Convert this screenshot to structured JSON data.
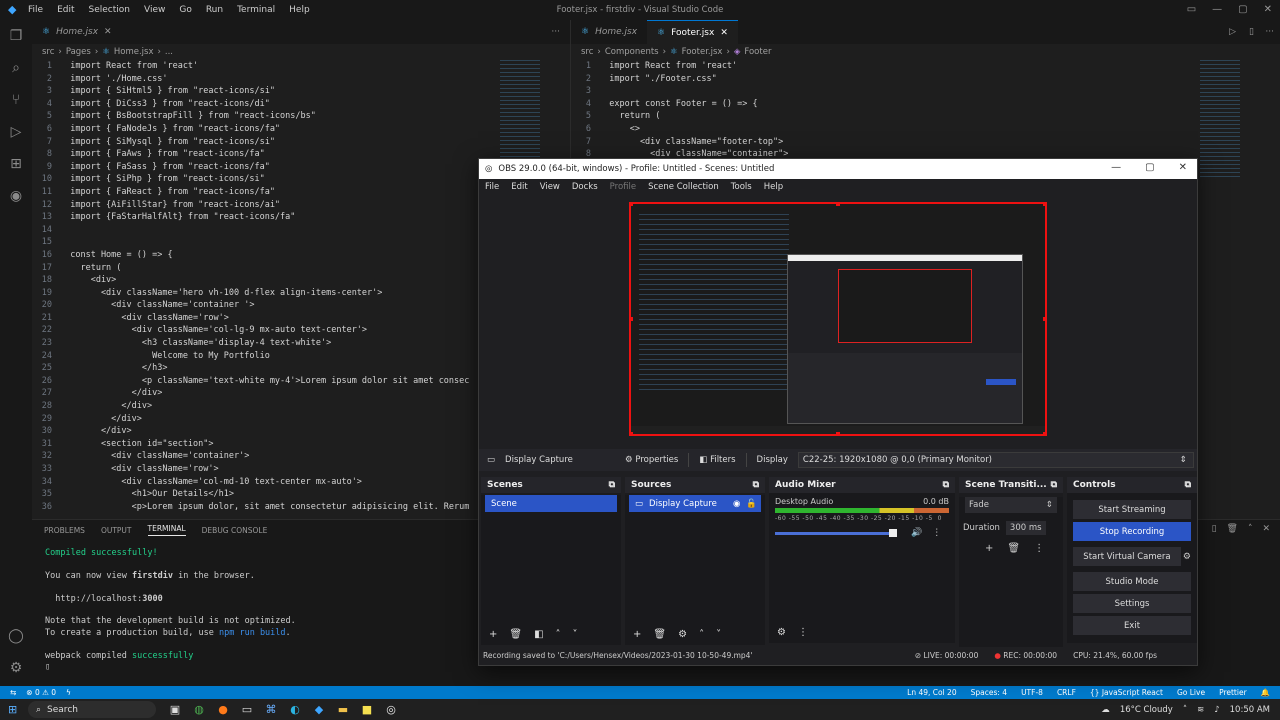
{
  "vscode": {
    "title": "Footer.jsx - firstdiv - Visual Studio Code",
    "menu": [
      "File",
      "Edit",
      "Selection",
      "View",
      "Go",
      "Run",
      "Terminal",
      "Help"
    ],
    "left_editor": {
      "tab_inactive": "Home.jsx",
      "breadcrumb": [
        "src",
        "Pages",
        "Home.jsx",
        "..."
      ],
      "lines": [
        {
          "n": "1",
          "t": "  import React from 'react'"
        },
        {
          "n": "2",
          "t": "  import './Home.css'"
        },
        {
          "n": "3",
          "t": "  import { SiHtml5 } from \"react-icons/si\""
        },
        {
          "n": "4",
          "t": "  import { DiCss3 } from \"react-icons/di\""
        },
        {
          "n": "5",
          "t": "  import { BsBootstrapFill } from \"react-icons/bs\""
        },
        {
          "n": "6",
          "t": "  import { FaNodeJs } from \"react-icons/fa\""
        },
        {
          "n": "7",
          "t": "  import { SiMysql } from \"react-icons/si\""
        },
        {
          "n": "8",
          "t": "  import { FaAws } from \"react-icons/fa\""
        },
        {
          "n": "9",
          "t": "  import { FaSass } from \"react-icons/fa\""
        },
        {
          "n": "10",
          "t": "  import { SiPhp } from \"react-icons/si\""
        },
        {
          "n": "11",
          "t": "  import { FaReact } from \"react-icons/fa\""
        },
        {
          "n": "12",
          "t": "  import {AiFillStar} from \"react-icons/ai\""
        },
        {
          "n": "13",
          "t": "  import {FaStarHalfAlt} from \"react-icons/fa\""
        },
        {
          "n": "14",
          "t": ""
        },
        {
          "n": "15",
          "t": ""
        },
        {
          "n": "16",
          "t": "  const Home = () => {"
        },
        {
          "n": "17",
          "t": "    return ("
        },
        {
          "n": "18",
          "t": "      <div>"
        },
        {
          "n": "19",
          "t": "        <div className='hero vh-100 d-flex align-items-center'>"
        },
        {
          "n": "20",
          "t": "          <div className='container '>"
        },
        {
          "n": "21",
          "t": "            <div className='row'>"
        },
        {
          "n": "22",
          "t": "              <div className='col-lg-9 mx-auto text-center'>"
        },
        {
          "n": "23",
          "t": "                <h3 className='display-4 text-white'>"
        },
        {
          "n": "24",
          "t": "                  Welcome to My Portfolio"
        },
        {
          "n": "25",
          "t": "                </h3>"
        },
        {
          "n": "26",
          "t": "                <p className='text-white my-4'>Lorem ipsum dolor sit amet consec"
        },
        {
          "n": "27",
          "t": "              </div>"
        },
        {
          "n": "28",
          "t": "            </div>"
        },
        {
          "n": "29",
          "t": "          </div>"
        },
        {
          "n": "30",
          "t": "        </div>"
        },
        {
          "n": "31",
          "t": "        <section id=\"section\">"
        },
        {
          "n": "32",
          "t": "          <div className='container'>"
        },
        {
          "n": "33",
          "t": "          <div className='row'>"
        },
        {
          "n": "34",
          "t": "            <div className='col-md-10 text-center mx-auto'>"
        },
        {
          "n": "35",
          "t": "              <h1>Our Details</h1>"
        },
        {
          "n": "36",
          "t": "              <p>Lorem ipsum dolor, sit amet consectetur adipisicing elit. Rerum"
        }
      ]
    },
    "right_editor": {
      "tab_inactive": "Home.jsx",
      "tab_active": "Footer.jsx",
      "breadcrumb": [
        "src",
        "Components",
        "Footer.jsx",
        "Footer"
      ],
      "lines": [
        {
          "n": "1",
          "t": "  import React from 'react'"
        },
        {
          "n": "2",
          "t": "  import \"./Footer.css\""
        },
        {
          "n": "3",
          "t": ""
        },
        {
          "n": "4",
          "t": "  export const Footer = () => {"
        },
        {
          "n": "5",
          "t": "    return ("
        },
        {
          "n": "6",
          "t": "      <>"
        },
        {
          "n": "7",
          "t": "        <div className=\"footer-top\">"
        },
        {
          "n": "8",
          "t": "          <div className=\"container\">"
        }
      ]
    },
    "panel": {
      "tabs": [
        "PROBLEMS",
        "OUTPUT",
        "TERMINAL",
        "DEBUG CONSOLE"
      ],
      "active_tab": "TERMINAL",
      "terminal": {
        "compiled": "Compiled successfully!",
        "view_prefix": "You can now view ",
        "view_app": "firstdiv",
        "view_suffix": " in the browser.",
        "local_prefix": "  http://localhost:",
        "local_port": "3000",
        "note1": "Note that the development build is not optimized.",
        "note2_prefix": "To create a production build, use ",
        "note2_cmd": "npm run build",
        "note2_suffix": ".",
        "webpack_prefix": "webpack compiled ",
        "webpack_status": "successfully"
      }
    },
    "statusbar": {
      "left": [
        "⊗ 0 ⚠ 0"
      ],
      "right": [
        "Ln 49, Col 20",
        "Spaces: 4",
        "UTF-8",
        "CRLF",
        "{} JavaScript React",
        "Go Live",
        "Prettier"
      ]
    }
  },
  "obs": {
    "title": "OBS 29.0.0 (64-bit, windows) - Profile: Untitled - Scenes: Untitled",
    "menu": [
      "File",
      "Edit",
      "View",
      "Docks",
      "Profile",
      "Scene Collection",
      "Tools",
      "Help"
    ],
    "source_bar": {
      "source": "Display Capture",
      "properties": "Properties",
      "filters": "Filters",
      "display_label": "Display",
      "display_value": "C22-25: 1920x1080 @ 0,0 (Primary Monitor)"
    },
    "scenes": {
      "header": "Scenes",
      "items": [
        "Scene"
      ]
    },
    "sources": {
      "header": "Sources",
      "items": [
        "Display Capture"
      ]
    },
    "mixer": {
      "header": "Audio Mixer",
      "channel": "Desktop Audio",
      "level": "0.0 dB",
      "ticks": "-60 -55 -50 -45 -40 -35 -30 -25 -20 -15 -10 -5  0"
    },
    "transitions": {
      "header": "Scene Transiti...",
      "type": "Fade",
      "duration_label": "Duration",
      "duration_value": "300 ms"
    },
    "controls": {
      "header": "Controls",
      "buttons": [
        "Start Streaming",
        "Stop Recording",
        "Start Virtual Camera",
        "Studio Mode",
        "Settings",
        "Exit"
      ]
    },
    "status": {
      "saved": "Recording saved to 'C:/Users/Hensex/Videos/2023-01-30 10-50-49.mp4'",
      "live": "LIVE: 00:00:00",
      "rec": "REC: 00:00:00",
      "cpu": "CPU: 21.4%, 60.00 fps"
    },
    "accent": "#2b55c6"
  },
  "taskbar": {
    "search": "Search",
    "weather": "16°C  Cloudy",
    "time": "10:50 AM"
  }
}
